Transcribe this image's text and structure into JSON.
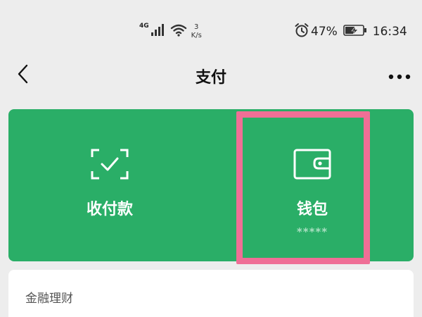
{
  "status_bar": {
    "network": "4G",
    "speed_value": "3",
    "speed_unit": "K/s",
    "battery": "47%",
    "time": "16:34"
  },
  "nav": {
    "title": "支付"
  },
  "pay_card": {
    "receive": {
      "label": "收付款",
      "icon": "scan-check-icon"
    },
    "wallet": {
      "label": "钱包",
      "balance_masked": "*****",
      "icon": "wallet-icon"
    },
    "background_color": "#2aae67",
    "highlight_color": "#ef6f96"
  },
  "finance": {
    "title": "金融理财"
  }
}
